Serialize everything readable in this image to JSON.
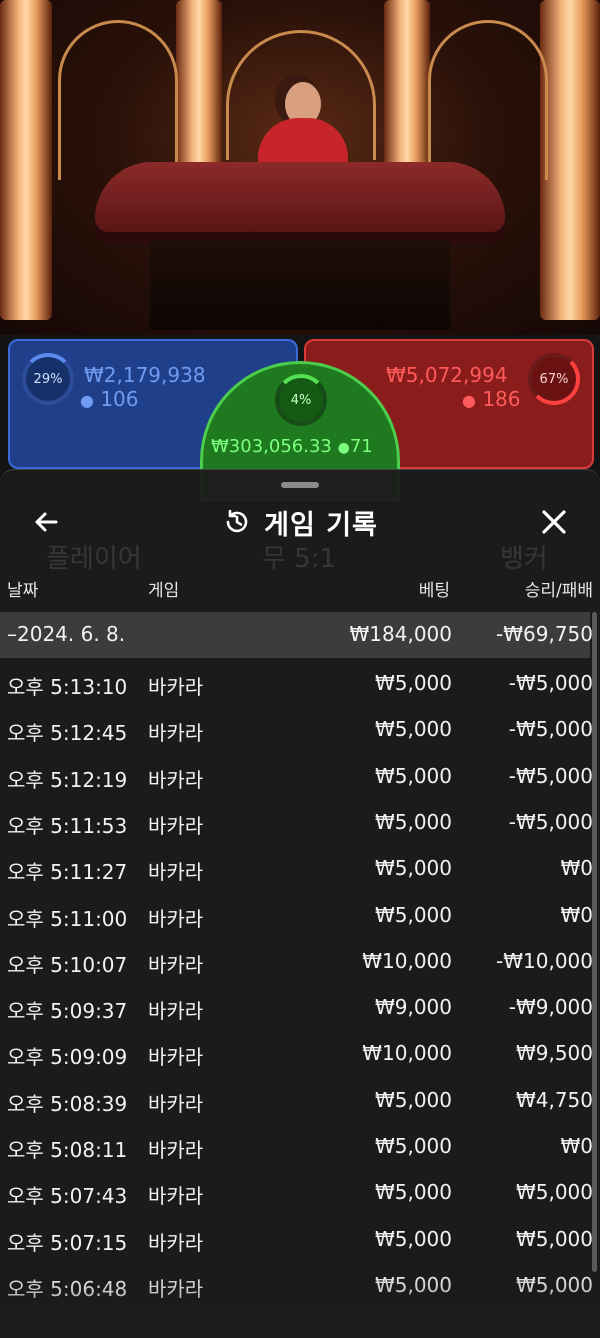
{
  "stage": {
    "player": {
      "percent": "29%",
      "amount": "₩2,179,938",
      "players": "106"
    },
    "banker": {
      "percent": "67%",
      "amount": "₩5,072,994",
      "players": "186"
    },
    "tie": {
      "percent": "4%",
      "amount": "₩303,056.33",
      "players": "71"
    }
  },
  "history": {
    "title": "게임 기록",
    "background_tabs": [
      "플레이어",
      "무 5:1",
      "뱅커"
    ],
    "columns": {
      "date": "날짜",
      "game": "게임",
      "bet": "베팅",
      "result": "승리/패배"
    },
    "summary": {
      "date": "–2024. 6. 8.",
      "bet": "₩184,000",
      "result": "-₩69,750"
    },
    "rows": [
      {
        "time": "오후 5:13:10",
        "game": "바카라",
        "bet": "₩5,000",
        "result": "-₩5,000"
      },
      {
        "time": "오후 5:12:45",
        "game": "바카라",
        "bet": "₩5,000",
        "result": "-₩5,000"
      },
      {
        "time": "오후 5:12:19",
        "game": "바카라",
        "bet": "₩5,000",
        "result": "-₩5,000"
      },
      {
        "time": "오후 5:11:53",
        "game": "바카라",
        "bet": "₩5,000",
        "result": "-₩5,000"
      },
      {
        "time": "오후 5:11:27",
        "game": "바카라",
        "bet": "₩5,000",
        "result": "₩0"
      },
      {
        "time": "오후 5:11:00",
        "game": "바카라",
        "bet": "₩5,000",
        "result": "₩0"
      },
      {
        "time": "오후 5:10:07",
        "game": "바카라",
        "bet": "₩10,000",
        "result": "-₩10,000"
      },
      {
        "time": "오후 5:09:37",
        "game": "바카라",
        "bet": "₩9,000",
        "result": "-₩9,000"
      },
      {
        "time": "오후 5:09:09",
        "game": "바카라",
        "bet": "₩10,000",
        "result": "₩9,500"
      },
      {
        "time": "오후 5:08:39",
        "game": "바카라",
        "bet": "₩5,000",
        "result": "₩4,750"
      },
      {
        "time": "오후 5:08:11",
        "game": "바카라",
        "bet": "₩5,000",
        "result": "₩0"
      },
      {
        "time": "오후 5:07:43",
        "game": "바카라",
        "bet": "₩5,000",
        "result": "₩5,000"
      },
      {
        "time": "오후 5:07:15",
        "game": "바카라",
        "bet": "₩5,000",
        "result": "₩5,000"
      },
      {
        "time": "오후 5:06:48",
        "game": "바카라",
        "bet": "₩5,000",
        "result": "₩5,000"
      }
    ]
  },
  "icons": {
    "back": "arrow-left-icon",
    "history": "history-clock-icon",
    "close": "close-icon",
    "person": "person-icon"
  },
  "colors": {
    "player": "#1f3f8a",
    "banker": "#8a1c1c",
    "tie": "#1f7a1f",
    "sheet": "#1c1c1c",
    "summary_row": "#3c3c3c"
  }
}
